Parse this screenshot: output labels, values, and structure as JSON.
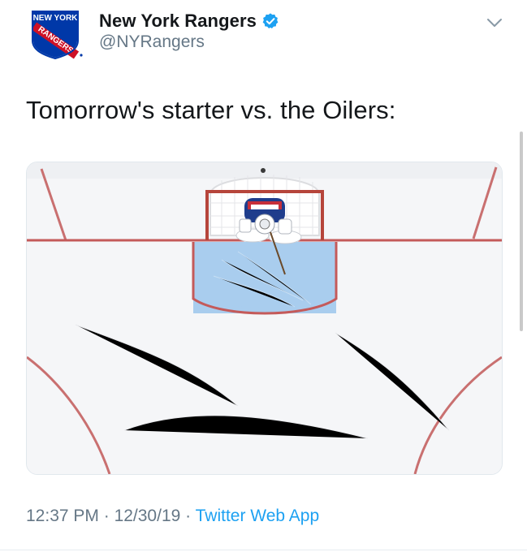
{
  "tweet": {
    "author": {
      "display_name": "New York Rangers",
      "handle": "@NYRangers",
      "verified": true,
      "avatar_logo_text": [
        "NEW YORK",
        "RANGERS"
      ]
    },
    "text": "Tomorrow's starter vs. the Oilers:",
    "timestamp_time": "12:37 PM",
    "separator": " · ",
    "timestamp_date": "12/30/19",
    "source": "Twitter Web App"
  },
  "icons": {
    "verified": "verified-badge-icon",
    "caret": "chevron-down-icon"
  },
  "colors": {
    "text_primary": "#14171a",
    "text_secondary": "#657786",
    "link": "#1da1f2",
    "verified": "#1da1f2",
    "rangers_blue": "#0038a8",
    "rangers_red": "#ce1126"
  }
}
